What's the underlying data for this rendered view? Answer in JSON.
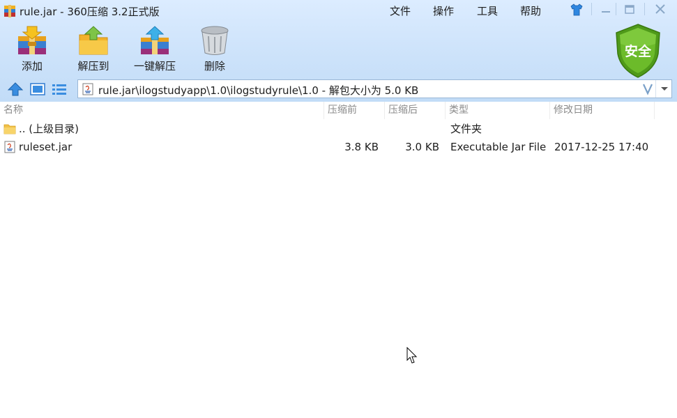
{
  "window": {
    "title": "rule.jar - 360压缩 3.2正式版",
    "app_icon": "archive-icon"
  },
  "menu": {
    "file": "文件",
    "operations": "操作",
    "tools": "工具",
    "help": "帮助"
  },
  "titlebar_icons": {
    "skin": "shirt-icon",
    "minimize": "minimize-icon",
    "maximize": "maximize-icon",
    "close": "close-icon"
  },
  "toolbar": {
    "add": {
      "label": "添加",
      "icon": "add-archive-icon"
    },
    "extract_to": {
      "label": "解压到",
      "icon": "folder-extract-icon"
    },
    "one_click_extract": {
      "label": "一键解压",
      "icon": "one-click-extract-icon"
    },
    "delete": {
      "label": "删除",
      "icon": "trash-icon"
    }
  },
  "security_badge": {
    "label": "安全",
    "icon": "shield-icon",
    "color": "#5aa51e"
  },
  "nav": {
    "up_icon": "arrow-up-icon",
    "view_icon": "thumbnail-view-icon",
    "list_icon": "list-view-icon"
  },
  "address": {
    "text": "rule.jar\\ilogstudyapp\\1.0\\ilogstudyrule\\1.0 - 解包大小为 5.0 KB",
    "v_icon": "chevron-v-icon",
    "dropdown_icon": "chevron-down-icon"
  },
  "columns": {
    "name": "名称",
    "packed": "压缩前",
    "unpacked": "压缩后",
    "type": "类型",
    "modified": "修改日期"
  },
  "rows": [
    {
      "name": ".. (上级目录)",
      "packed": "",
      "unpacked": "",
      "type": "文件夹",
      "modified": "",
      "icon": "folder-icon"
    },
    {
      "name": "ruleset.jar",
      "packed": "3.8 KB",
      "unpacked": "3.0 KB",
      "type": "Executable Jar File",
      "modified": "2017-12-25 17:40",
      "icon": "jar-file-icon"
    }
  ],
  "colors": {
    "header_top": "#dcecff",
    "header_bottom": "#c2dcf7",
    "column_text": "#8a8a8a",
    "accent_blue": "#3a8de0"
  }
}
